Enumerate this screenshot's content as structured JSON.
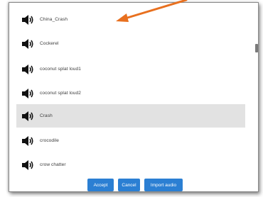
{
  "sound_list": {
    "items": [
      {
        "label": "China_Crash",
        "icon": "speaker-icon",
        "selected": false
      },
      {
        "label": "Cockerel",
        "icon": "speaker-icon",
        "selected": false
      },
      {
        "label": "coconut splat loud1",
        "icon": "speaker-icon",
        "selected": false
      },
      {
        "label": "coconut splat loud2",
        "icon": "speaker-icon",
        "selected": false
      },
      {
        "label": "Crash",
        "icon": "speaker-icon",
        "selected": true
      },
      {
        "label": "crocodile",
        "icon": "speaker-icon",
        "selected": false
      },
      {
        "label": "crow chatter",
        "icon": "speaker-icon",
        "selected": false
      }
    ]
  },
  "buttons": {
    "accept": "Accept",
    "cancel": "Cancel",
    "import_audio": "Import audio"
  },
  "colors": {
    "button_bg": "#2b7fd3",
    "selected_row": "#e2e2e2",
    "annotation_arrow": "#e8701f"
  }
}
